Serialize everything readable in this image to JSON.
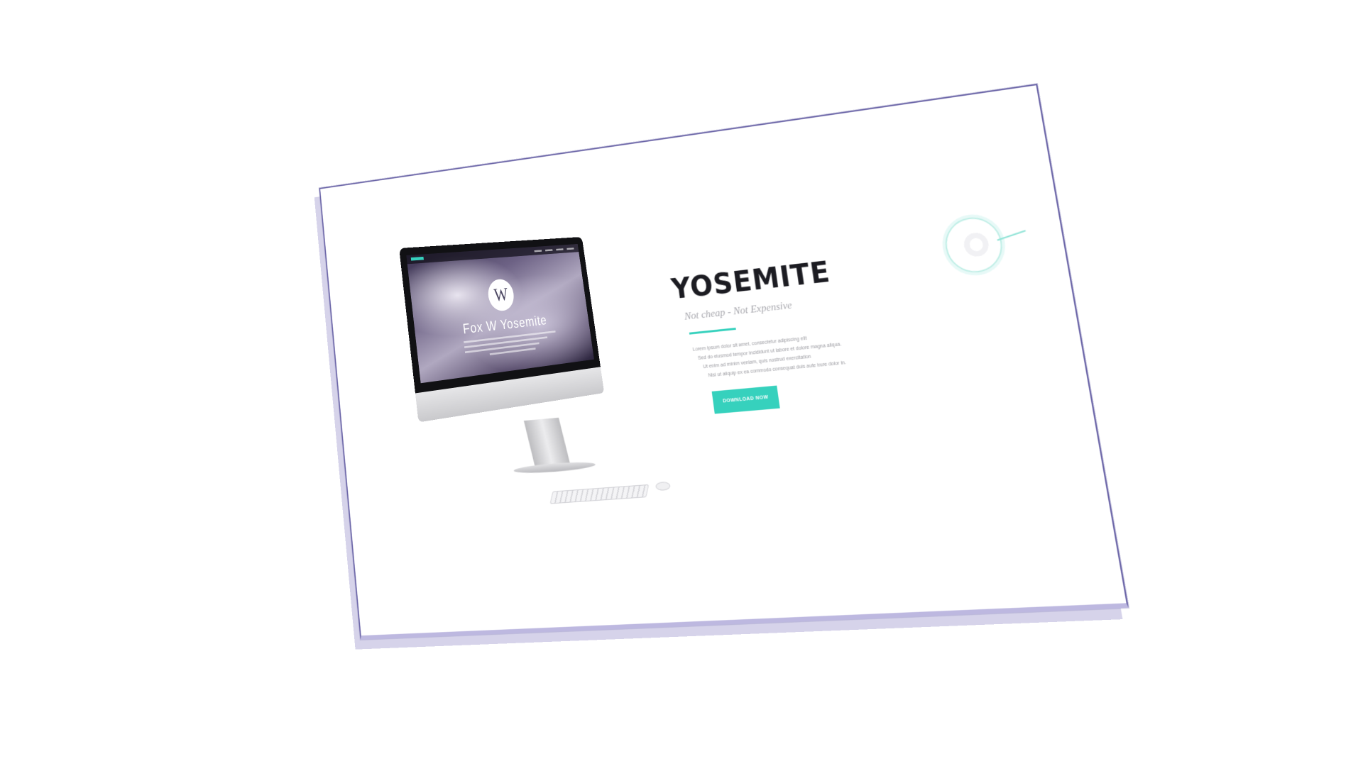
{
  "hero": {
    "title": "YOSEMITE",
    "subtitle": "Not cheap - Not Expensive",
    "description": [
      "Lorem ipsum dolor sit amet, consectetur adipiscing elit",
      "Sed do eiusmod tempor incididunt ut labore et dolore magna aliqua.",
      "Ut enim ad minim veniam, quis nostrud exercitation",
      "Nisi ut aliquip ex ea commodo consequat duis aute irure dolor in."
    ],
    "cta_label": "DOWNLOAD NOW"
  },
  "mockup": {
    "screen_logo": "W",
    "screen_title": "Fox W Yosemite"
  },
  "colors": {
    "accent": "#36d1bd",
    "panel_edge": "#6c66a8",
    "title": "#1c1c22",
    "muted": "#a8a8ae"
  }
}
